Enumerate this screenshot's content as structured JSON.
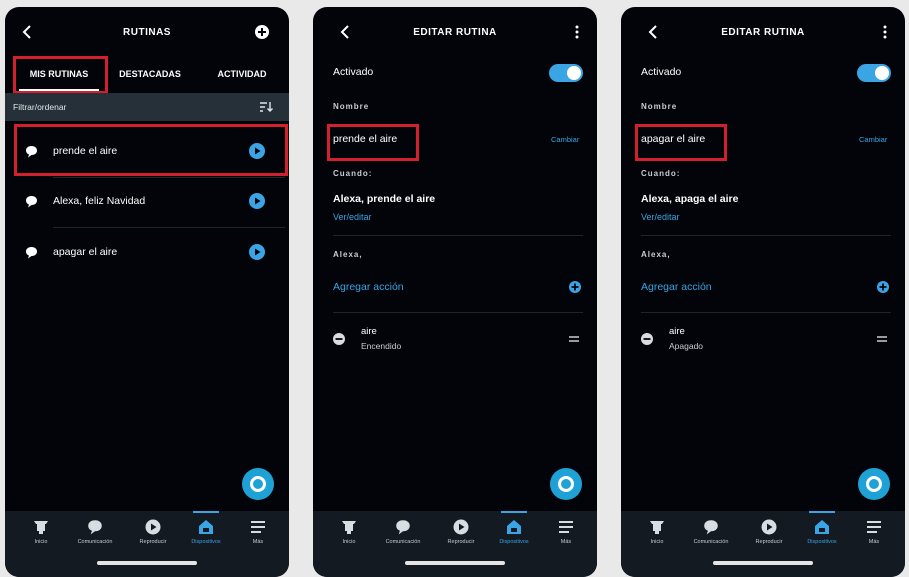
{
  "colors": {
    "accent": "#3aa4e4",
    "highlight": "#d2202e",
    "background": "#020409",
    "navbar": "#131a22",
    "filterbar": "#253038"
  },
  "nav_labels": [
    "Inicio",
    "Comunicación",
    "Reproducir",
    "Dispositivos",
    "Más"
  ],
  "screen1": {
    "title": "RUTINAS",
    "tabs": [
      "MIS RUTINAS",
      "DESTACADAS",
      "ACTIVIDAD"
    ],
    "filter_label": "Filtrar/ordenar",
    "routines": [
      "prende el aire",
      "Alexa, feliz Navidad",
      "apagar el aire"
    ]
  },
  "screen2": {
    "title": "EDITAR RUTINA",
    "enabled_label": "Activado",
    "enabled": true,
    "name_label": "Nombre",
    "name_value": "prende el aire",
    "change_label": "Cambiar",
    "when_label": "Cuando:",
    "trigger": "Alexa, prende el aire",
    "view_edit": "Ver/editar",
    "alexa_label": "Alexa,",
    "add_action": "Agregar acción",
    "action_device": "aire",
    "action_state": "Encendido"
  },
  "screen3": {
    "title": "EDITAR RUTINA",
    "enabled_label": "Activado",
    "enabled": true,
    "name_label": "Nombre",
    "name_value": "apagar el aire",
    "change_label": "Cambiar",
    "when_label": "Cuando:",
    "trigger": "Alexa, apaga el aire",
    "view_edit": "Ver/editar",
    "alexa_label": "Alexa,",
    "add_action": "Agregar acción",
    "action_device": "aire",
    "action_state": "Apagado"
  }
}
